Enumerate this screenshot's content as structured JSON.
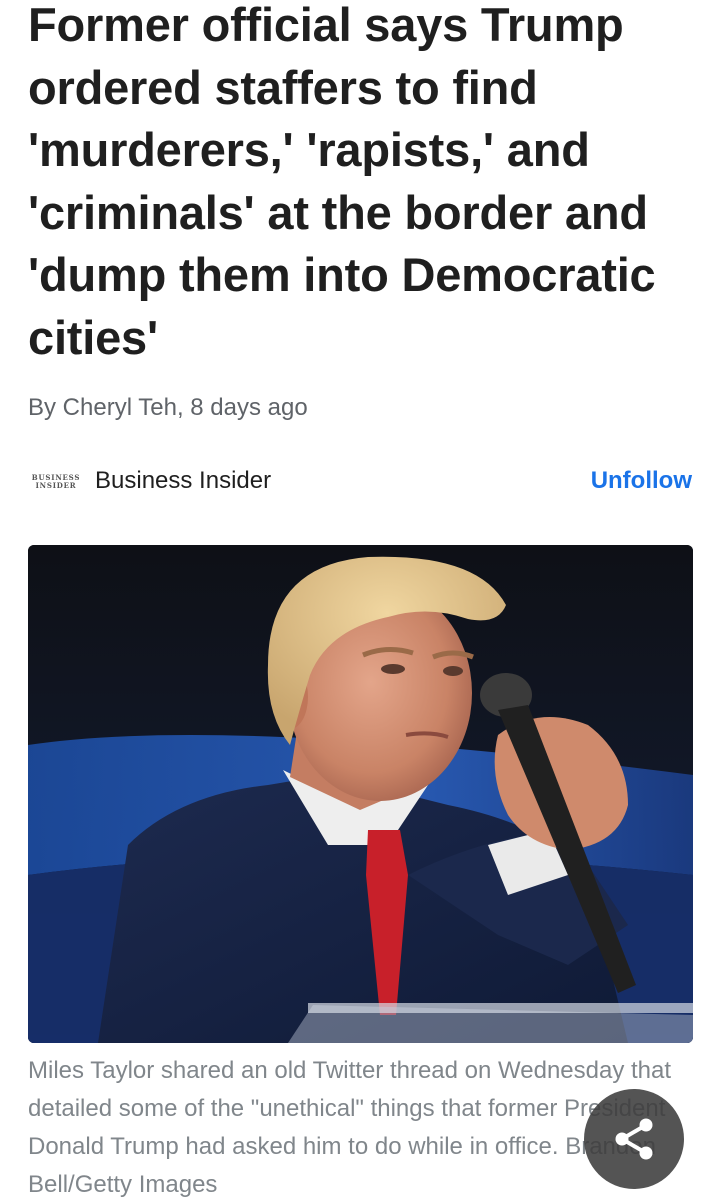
{
  "article": {
    "headline": "Former official says Trump ordered staffers to find 'murderers,' 'rapists,' and 'criminals' at the border and 'dump them into Democratic cities'",
    "byline": "By Cheryl Teh, 8 days ago"
  },
  "source": {
    "logo_line1": "BUSINESS",
    "logo_line2": "INSIDER",
    "name": "Business Insider",
    "follow_label": "Unfollow"
  },
  "photo": {
    "caption": "Miles Taylor shared an old Twitter thread on Wednesday that detailed some of the \"unethical\" things that former President Donald Trump had asked him to do while in office. Brandon Bell/Getty Images"
  },
  "share": {
    "icon": "share-icon"
  },
  "colors": {
    "link_blue": "#1a73e8",
    "headline": "#1f1f1f",
    "meta_gray": "#5f6368",
    "caption_gray": "#80868b",
    "share_button_bg": "#3c3c3c"
  }
}
